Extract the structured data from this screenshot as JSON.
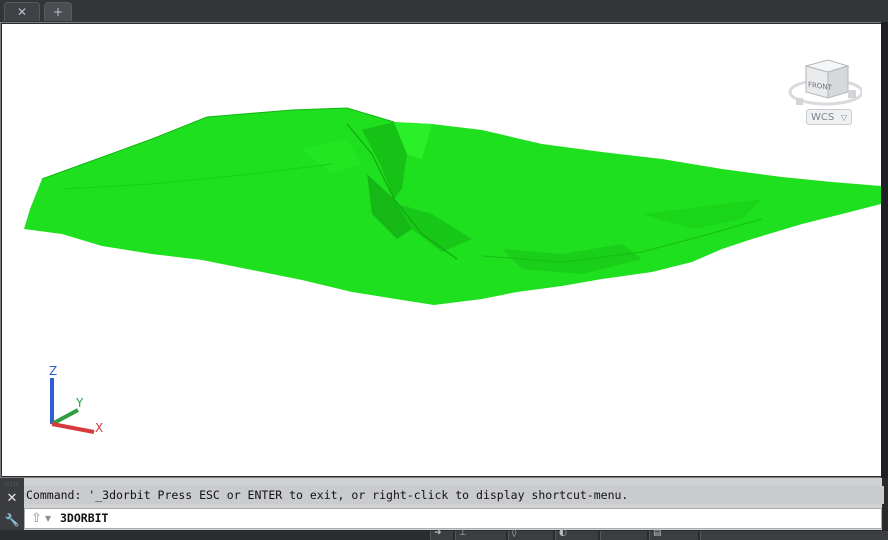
{
  "tabs": {
    "close_glyph": "✕",
    "new_glyph": "+"
  },
  "viewcube": {
    "face_label": "FRONT",
    "coordinate_system": "WCS",
    "dropdown_glyph": "▽"
  },
  "ucs_icon": {
    "x_label": "X",
    "y_label": "Y",
    "z_label": "Z"
  },
  "command_line": {
    "history": "Command: '_3dorbit Press ESC or ENTER to exit, or right-click to display shortcut-menu.",
    "current_input": "3DORBIT",
    "close_glyph": "✕",
    "customize_glyph": "🔧",
    "prompt_glyph": "⇧",
    "recent_glyph": "▼"
  },
  "colors": {
    "terrain": "#1ee01e",
    "terrain_dark": "#14b414",
    "viewport_bg": "#ffffff",
    "axis_x": "#d63a3a",
    "axis_y": "#2e9e3e",
    "axis_z": "#2f5fd6"
  },
  "statusbar": {
    "icons": [
      "arrow-icon",
      "snap-icon",
      "osnap-icon",
      "ortho-icon",
      "polar-icon",
      "model-icon",
      "annotation-icon"
    ]
  }
}
